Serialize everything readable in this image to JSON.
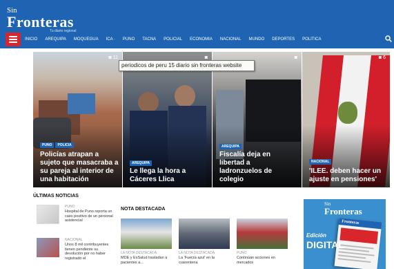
{
  "header": {
    "logo_sin": "Sin",
    "logo_main": "Fronteras",
    "logo_tag": "Tu diario regional",
    "nav": [
      "INICIO",
      "AREQUIPA",
      "MOQUEGUA",
      "ICA ·",
      "PUNO",
      "TACNA",
      "POLICIAL",
      "ECONOMIA",
      "NACIONAL",
      "MUNDO",
      "DEPORTES",
      "POLITICA"
    ]
  },
  "tooltip": "periodicos de peru 15 diario sin fronteras website",
  "hero": [
    {
      "badges": [
        "PUNO",
        "POLICIA"
      ],
      "title": "Policías atrapan a sujeto que masacraba a su pareja al interior de una habitación",
      "camera": "◙ 11"
    },
    {
      "badges": [
        "AREQUIPA"
      ],
      "title": "Le llega la hora a Cáceres Llica",
      "camera": "◙"
    },
    {
      "badges": [
        "AREQUIPA"
      ],
      "title": "Fiscalía deja en libertad a ladronzuelos de colegio",
      "camera": "◙"
    },
    {
      "badges": [
        "NACIONAL"
      ],
      "title": "'ILEE. deben hacer un ajuste en pensiones'",
      "camera": "◙ 6"
    }
  ],
  "latest": {
    "title": "ÚLTIMAS NOTICIAS",
    "items": [
      {
        "category": "PUNO",
        "text": "Hospital de Puno reporta un caso positivo de un personal asistencial"
      },
      {
        "category": "NACIONAL",
        "text": "Unos 8 mil contribuyentes tienen pendiente su devolución por no haber registrado el"
      }
    ]
  },
  "featured": {
    "title": "NOTA DESTACADA",
    "items": [
      {
        "category": "LA NOTA DESTACADA",
        "text": "MDE y EsSalud trasladan a pacientes a..."
      },
      {
        "category": "LA NOTA DESTACADA",
        "text": "La 'Fuerza azul' en la cuarentena"
      },
      {
        "category": "PUNO",
        "text": "Continúan acciones en mercados"
      }
    ]
  },
  "ad": {
    "logo_sin": "Sin",
    "logo_main": "Fronteras",
    "edicion": "Edición",
    "digital": "DIGITAL",
    "paper_head": "Fronteras"
  },
  "colors": {
    "brand": "#1f64b2",
    "menu": "#d9262c",
    "badge": "#1f64b2"
  },
  "icons": {
    "menu": "hamburger-icon",
    "search": "search-icon",
    "camera": "camera-icon"
  }
}
